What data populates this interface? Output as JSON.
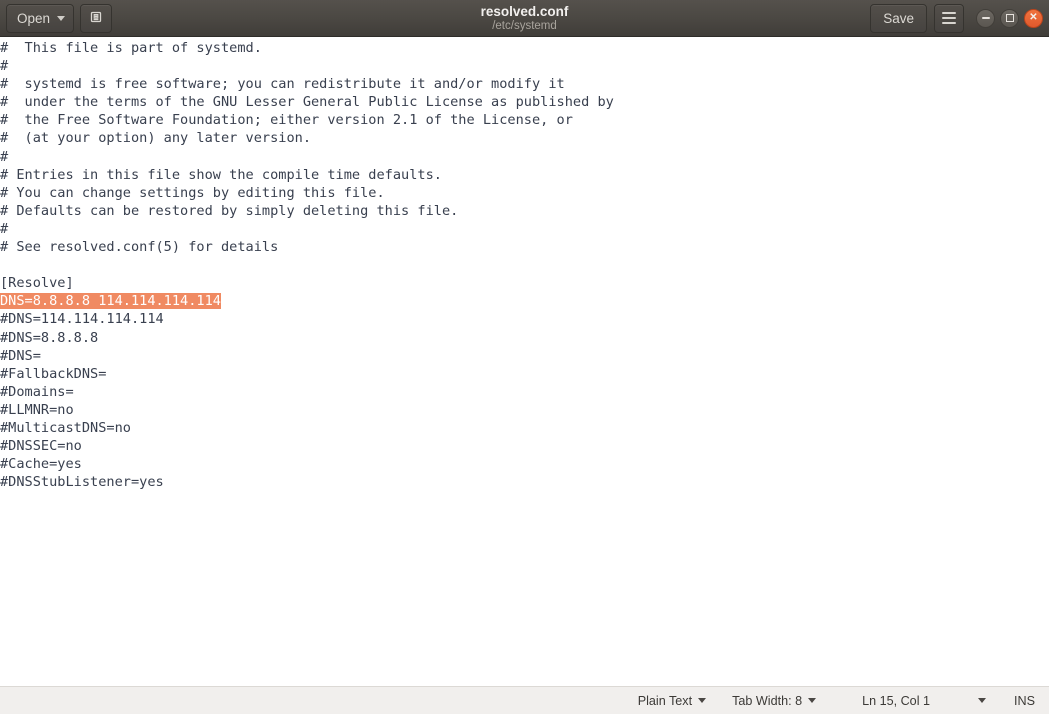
{
  "window": {
    "title": "resolved.conf",
    "subtitle": "/etc/systemd"
  },
  "toolbar": {
    "open_label": "Open",
    "open_icon": "chevron-down-icon",
    "new_doc_icon": "new-document-icon",
    "save_label": "Save",
    "menu_icon": "hamburger-menu-icon",
    "minimize_icon": "minimize-icon",
    "maximize_icon": "maximize-icon",
    "close_icon": "close-icon"
  },
  "colors": {
    "headerbar_top": "#55514c",
    "headerbar_bottom": "#403d39",
    "close_button": "#e85d28",
    "selection_background": "#f08a62",
    "selection_text": "#ffffff",
    "editor_text": "#39404f",
    "statusbar_background": "#f1efed"
  },
  "editor": {
    "lines": [
      "#  This file is part of systemd.",
      "#",
      "#  systemd is free software; you can redistribute it and/or modify it",
      "#  under the terms of the GNU Lesser General Public License as published by",
      "#  the Free Software Foundation; either version 2.1 of the License, or",
      "#  (at your option) any later version.",
      "#",
      "# Entries in this file show the compile time defaults.",
      "# You can change settings by editing this file.",
      "# Defaults can be restored by simply deleting this file.",
      "#",
      "# See resolved.conf(5) for details",
      "",
      "[Resolve]",
      "DNS=8.8.8.8 114.114.114.114",
      "#DNS=114.114.114.114",
      "#DNS=8.8.8.8",
      "#DNS=",
      "#FallbackDNS=",
      "#Domains=",
      "#LLMNR=no",
      "#MulticastDNS=no",
      "#DNSSEC=no",
      "#Cache=yes",
      "#DNSStubListener=yes"
    ],
    "selected_line_index": 14,
    "selected_text": "DNS=8.8.8.8 114.114.114.114"
  },
  "statusbar": {
    "language": "Plain Text",
    "tab_width": "Tab Width: 8",
    "cursor_position": "Ln 15, Col 1",
    "insert_mode": "INS"
  }
}
